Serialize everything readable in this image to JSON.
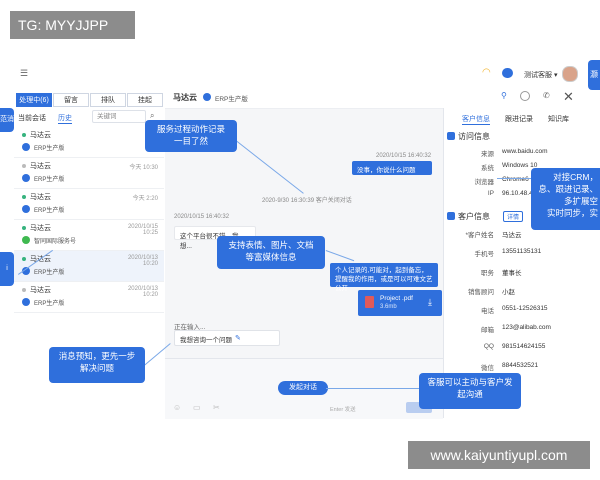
{
  "watermark_top": "TG: MYYJJPP",
  "watermark_bottom": "www.kaiyuntiyupl.com",
  "topbar": {
    "agent_label": "测试客服 ▾",
    "edge_fragment": "灏"
  },
  "left": {
    "segments": [
      "处理中(6)",
      "留言",
      "排队",
      "挂起"
    ],
    "tabs": [
      "当前会话",
      "历史"
    ],
    "search_placeholder": "关键词",
    "items": [
      {
        "name": "马达云",
        "source": "ERP生产版",
        "time": "今天",
        "dot": "green",
        "badge": "blue"
      },
      {
        "name": "马达云",
        "source": "ERP生产版",
        "time": "今天 10:30",
        "dot": "gray",
        "badge": "blue"
      },
      {
        "name": "马达云",
        "source": "ERP生产版",
        "time": "今天 2:20",
        "dot": "green",
        "badge": "blue"
      },
      {
        "name": "马达云",
        "source": "智同国际服务号",
        "time": "2020/10/15 10:25",
        "dot": "green",
        "badge": "green"
      },
      {
        "name": "马达云",
        "source": "ERP生产版",
        "time": "2020/10/13 10:20",
        "dot": "green",
        "badge": "blue"
      },
      {
        "name": "马达云",
        "source": "ERP生产版",
        "time": "2020/10/13 10:20",
        "dot": "gray",
        "badge": "blue"
      }
    ]
  },
  "chat": {
    "title": "马达云",
    "source": "ERP生产版",
    "msg1_time": "2020/10/15  16:40:32",
    "msg1": "没事，你说什么问题",
    "system_note": "2020-9/30 16:30:39  客户关闭对话",
    "msg2_time": "2020/10/15  16:40:32",
    "msg2": "这个平台很不错，我想...",
    "msg3": "个人记录的,可能对，起到备忘，提醒我的作用，或是可以可难文艺公开",
    "msg3_time": "2020/10/15  16:40:32",
    "file_name": "Project .pdf",
    "file_size": "3.6mb",
    "typing_label": "正在输入...",
    "typing_text": "我想咨询一个问题",
    "start_button": "发起对话",
    "input_hint": "Enter 发送"
  },
  "right": {
    "tabs": [
      "客户信息",
      "跟进记录",
      "知识库"
    ],
    "visit_title": "访问信息",
    "visit": [
      {
        "k": "来源",
        "v": "www.baidu.com"
      },
      {
        "k": "系统",
        "v": "Windows 10"
      },
      {
        "k": "浏览器",
        "v": "Chrome6"
      },
      {
        "k": "IP",
        "v": "96.10.48.4"
      }
    ],
    "customer_title": "客户信息",
    "detail_btn": "详情",
    "customer": [
      {
        "k": "*客户姓名",
        "v": "马达云"
      },
      {
        "k": "手机号",
        "v": "13551135131"
      },
      {
        "k": "职务",
        "v": "董事长"
      },
      {
        "k": "销售顾问",
        "v": "小赵"
      },
      {
        "k": "电话",
        "v": "0551-12526315"
      },
      {
        "k": "邮箱",
        "v": "123@alibab.com"
      },
      {
        "k": "QQ",
        "v": "981514624155"
      },
      {
        "k": "微信",
        "v": "8844532521"
      },
      {
        "k": "地址",
        "v": "合肥"
      }
    ]
  },
  "callouts": {
    "record": [
      "服务过程动作记录",
      "一目了然"
    ],
    "media": [
      "支持表情、图片、文档",
      "等富媒体信息"
    ],
    "preview": [
      "消息预知，更先一步",
      "解决问题"
    ],
    "proactive": [
      "客服可以主动与客户发",
      "起沟通"
    ],
    "crm": [
      "对接CRM，",
      "息、跟进记录、",
      "多扩展空",
      "实时同步，实"
    ],
    "left_edge_top": "范消",
    "left_edge_bottom": "i"
  }
}
